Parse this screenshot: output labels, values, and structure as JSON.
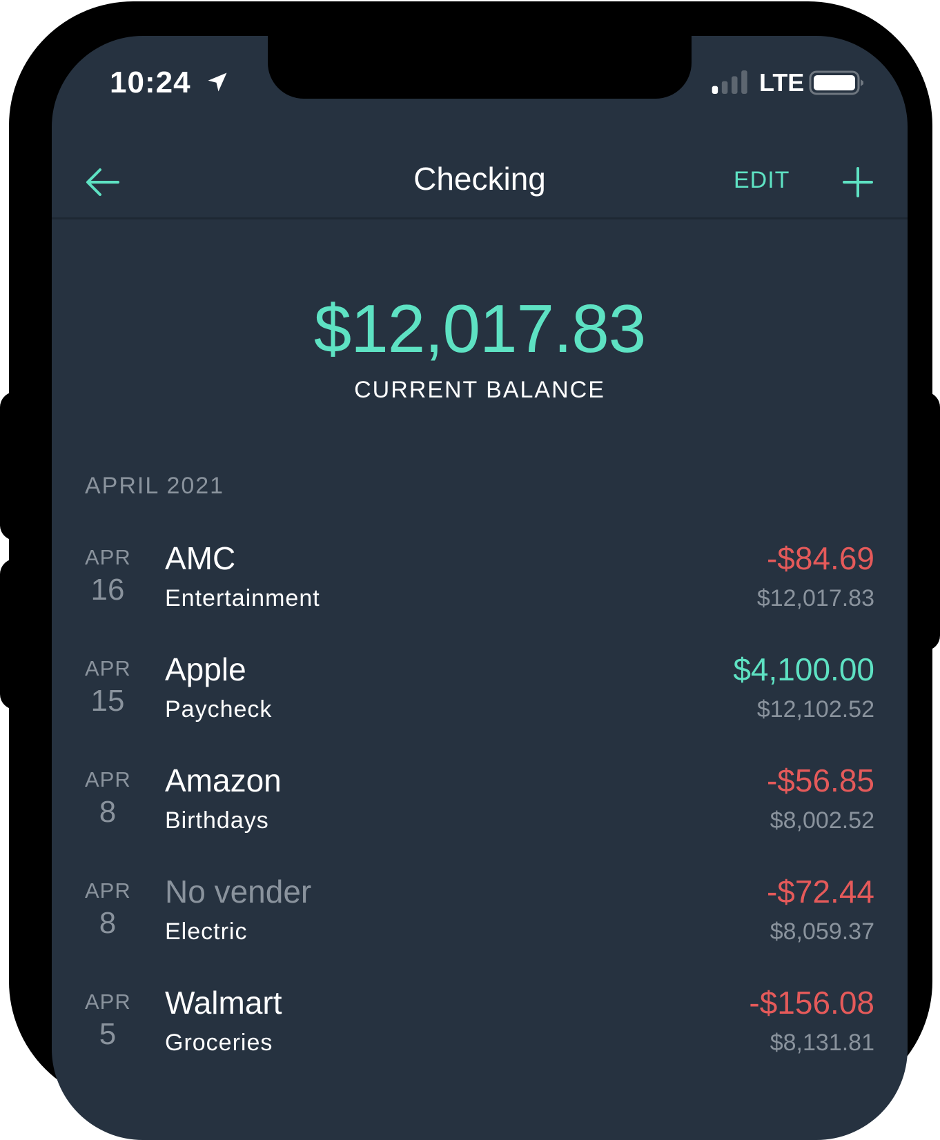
{
  "status_bar": {
    "time": "10:24",
    "location_icon": "location-arrow-icon",
    "signal_icon": "cellular-signal-icon",
    "signal_bars_active": 1,
    "signal_bars_total": 4,
    "network": "LTE",
    "battery_icon": "battery-icon"
  },
  "nav": {
    "back_icon": "arrow-left-icon",
    "title": "Checking",
    "edit_label": "EDIT",
    "add_icon": "plus-icon"
  },
  "balance": {
    "amount": "$12,017.83",
    "label": "CURRENT BALANCE"
  },
  "section": {
    "header": "APRIL 2021"
  },
  "transactions": [
    {
      "month": "APR",
      "day": "16",
      "vendor": "AMC",
      "vendor_muted": false,
      "category": "Entertainment",
      "amount": "-$84.69",
      "type": "debit",
      "running_balance": "$12,017.83"
    },
    {
      "month": "APR",
      "day": "15",
      "vendor": "Apple",
      "vendor_muted": false,
      "category": "Paycheck",
      "amount": "$4,100.00",
      "type": "credit",
      "running_balance": "$12,102.52"
    },
    {
      "month": "APR",
      "day": "8",
      "vendor": "Amazon",
      "vendor_muted": false,
      "category": "Birthdays",
      "amount": "-$56.85",
      "type": "debit",
      "running_balance": "$8,002.52"
    },
    {
      "month": "APR",
      "day": "8",
      "vendor": "No vender",
      "vendor_muted": true,
      "category": "Electric",
      "amount": "-$72.44",
      "type": "debit",
      "running_balance": "$8,059.37"
    },
    {
      "month": "APR",
      "day": "5",
      "vendor": "Walmart",
      "vendor_muted": false,
      "category": "Groceries",
      "amount": "-$156.08",
      "type": "debit",
      "running_balance": "$8,131.81"
    }
  ],
  "colors": {
    "background": "#263240",
    "accent": "#5ee2c3",
    "negative": "#e55a5a",
    "muted": "#8a939d",
    "text": "#ffffff"
  }
}
